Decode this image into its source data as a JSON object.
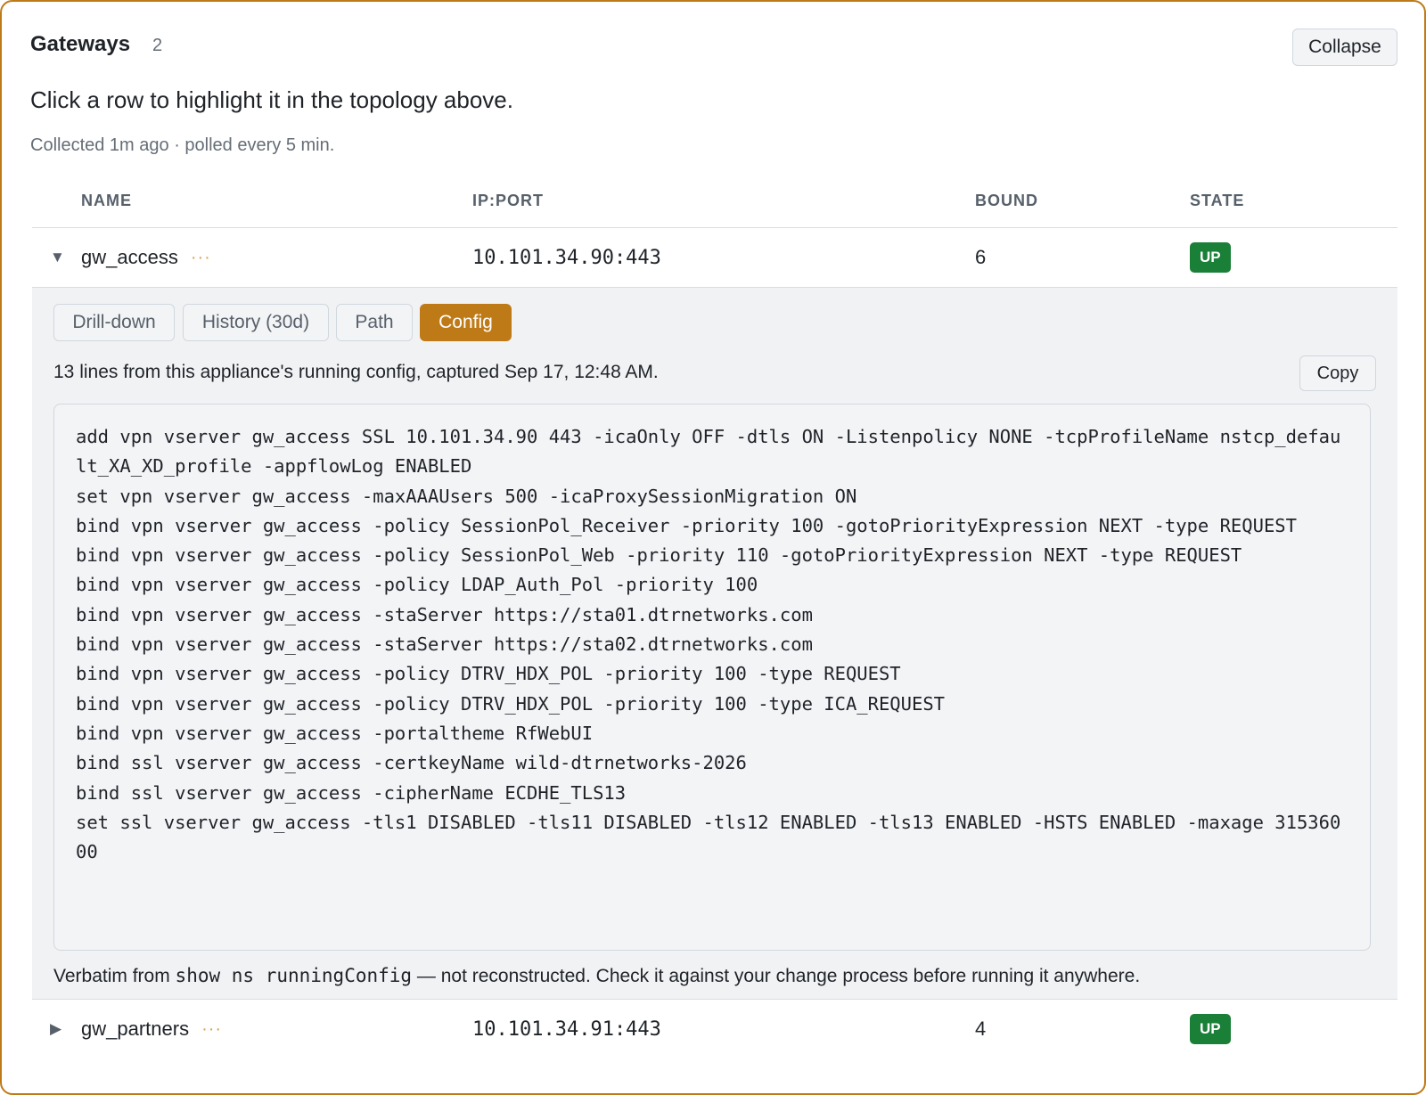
{
  "header": {
    "title": "Gateways",
    "count": "2",
    "collapse_label": "Collapse"
  },
  "subtitle": "Click a row to highlight it in the topology above.",
  "meta": "Collected 1m ago · polled every 5 min.",
  "table": {
    "columns": {
      "name": "NAME",
      "ip": "IP:PORT",
      "bound": "BOUND",
      "state": "STATE"
    },
    "rows": [
      {
        "caret": "▼",
        "name": "gw_access",
        "dots": "···",
        "ip": "10.101.34.90:443",
        "bound": "6",
        "state": "UP"
      },
      {
        "caret": "▶",
        "name": "gw_partners",
        "dots": "···",
        "ip": "10.101.34.91:443",
        "bound": "4",
        "state": "UP"
      }
    ]
  },
  "detail": {
    "tabs": [
      {
        "label": "Drill-down"
      },
      {
        "label": "History (30d)"
      },
      {
        "label": "Path"
      },
      {
        "label": "Config"
      }
    ],
    "active_tab": "Config",
    "description": "13 lines from this appliance's running config, captured Sep 17, 12:48 AM.",
    "copy_label": "Copy",
    "config_lines": [
      "add vpn vserver gw_access SSL 10.101.34.90 443 -icaOnly OFF -dtls ON -Listenpolicy NONE -tcpProfileName nstcp_default_XA_XD_profile -appflowLog ENABLED",
      "set vpn vserver gw_access -maxAAAUsers 500 -icaProxySessionMigration ON",
      "bind vpn vserver gw_access -policy SessionPol_Receiver -priority 100 -gotoPriorityExpression NEXT -type REQUEST",
      "bind vpn vserver gw_access -policy SessionPol_Web -priority 110 -gotoPriorityExpression NEXT -type REQUEST",
      "bind vpn vserver gw_access -policy LDAP_Auth_Pol -priority 100",
      "bind vpn vserver gw_access -staServer https://sta01.dtrnetworks.com",
      "bind vpn vserver gw_access -staServer https://sta02.dtrnetworks.com",
      "bind vpn vserver gw_access -policy DTRV_HDX_POL -priority 100 -type REQUEST",
      "bind vpn vserver gw_access -policy DTRV_HDX_POL -priority 100 -type ICA_REQUEST",
      "bind vpn vserver gw_access -portaltheme RfWebUI",
      "bind ssl vserver gw_access -certkeyName wild-dtrnetworks-2026",
      "bind ssl vserver gw_access -cipherName ECDHE_TLS13",
      "set ssl vserver gw_access -tls1 DISABLED -tls11 DISABLED -tls12 ENABLED -tls13 ENABLED -HSTS ENABLED -maxage 31536000"
    ],
    "note_prefix": "Verbatim from ",
    "note_command": "show ns runningConfig",
    "note_suffix": " — not reconstructed. Check it against your change process before running it anywhere."
  },
  "colors": {
    "accent": "#bf7a18",
    "status_up": "#1a7f37"
  }
}
